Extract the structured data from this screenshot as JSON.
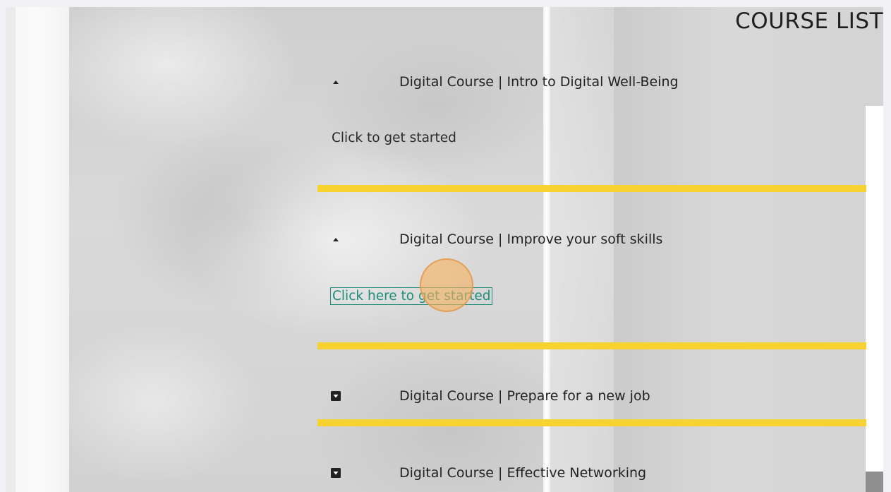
{
  "page": {
    "title": "COURSE LIST"
  },
  "courses": [
    {
      "title": "Digital Course | Intro to Digital Well-Being",
      "state": "expanded",
      "icon": "caret-up-icon",
      "link_label": "Click to get started"
    },
    {
      "title": "Digital Course | Improve your soft skills",
      "state": "expanded",
      "icon": "caret-up-icon",
      "link_label": "Click here to get started"
    },
    {
      "title": "Digital Course | Prepare for a new job",
      "state": "collapsed",
      "icon": "caret-down-square-icon"
    },
    {
      "title": "Digital Course | Effective Networking",
      "state": "collapsed",
      "icon": "caret-down-square-icon"
    }
  ],
  "colors": {
    "divider": "#f7d332",
    "link_focus": "#1f8d78",
    "click_marker": "#f6b15f"
  }
}
